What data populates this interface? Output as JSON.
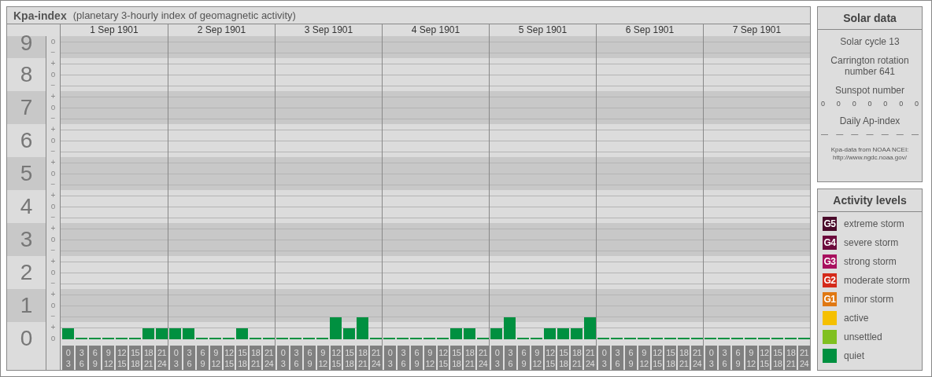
{
  "title": {
    "name": "Kpa-index",
    "subtitle": "(planetary 3-hourly index of geomagnetic activity)"
  },
  "chart": {
    "days": [
      {
        "date": "1 Sep 1901",
        "slots": [
          [
            "0",
            "3"
          ],
          [
            "3",
            "6"
          ],
          [
            "6",
            "9"
          ],
          [
            "9",
            "12"
          ],
          [
            "12",
            "15"
          ],
          [
            "15",
            "18"
          ],
          [
            "18",
            "21"
          ],
          [
            "21",
            "24"
          ]
        ]
      },
      {
        "date": "2 Sep 1901",
        "slots": [
          [
            "0",
            "3"
          ],
          [
            "3",
            "6"
          ],
          [
            "6",
            "9"
          ],
          [
            "9",
            "12"
          ],
          [
            "12",
            "15"
          ],
          [
            "15",
            "18"
          ],
          [
            "18",
            "21"
          ],
          [
            "21",
            "24"
          ]
        ]
      },
      {
        "date": "3 Sep 1901",
        "slots": [
          [
            "0",
            "3"
          ],
          [
            "3",
            "6"
          ],
          [
            "6",
            "9"
          ],
          [
            "9",
            "12"
          ],
          [
            "12",
            "15"
          ],
          [
            "15",
            "18"
          ],
          [
            "18",
            "21"
          ],
          [
            "21",
            "24"
          ]
        ]
      },
      {
        "date": "4 Sep 1901",
        "slots": [
          [
            "0",
            "3"
          ],
          [
            "3",
            "6"
          ],
          [
            "6",
            "9"
          ],
          [
            "9",
            "12"
          ],
          [
            "12",
            "15"
          ],
          [
            "15",
            "18"
          ],
          [
            "18",
            "21"
          ],
          [
            "21",
            "24"
          ]
        ]
      },
      {
        "date": "5 Sep 1901",
        "slots": [
          [
            "0",
            "3"
          ],
          [
            "3",
            "6"
          ],
          [
            "6",
            "9"
          ],
          [
            "9",
            "12"
          ],
          [
            "12",
            "15"
          ],
          [
            "15",
            "18"
          ],
          [
            "18",
            "21"
          ],
          [
            "21",
            "24"
          ]
        ]
      },
      {
        "date": "6 Sep 1901",
        "slots": [
          [
            "0",
            "3"
          ],
          [
            "3",
            "6"
          ],
          [
            "6",
            "9"
          ],
          [
            "9",
            "12"
          ],
          [
            "12",
            "15"
          ],
          [
            "15",
            "18"
          ],
          [
            "18",
            "21"
          ],
          [
            "21",
            "24"
          ]
        ]
      },
      {
        "date": "7 Sep 1901",
        "slots": [
          [
            "0",
            "3"
          ],
          [
            "3",
            "6"
          ],
          [
            "6",
            "9"
          ],
          [
            "9",
            "12"
          ],
          [
            "12",
            "15"
          ],
          [
            "15",
            "18"
          ],
          [
            "18",
            "21"
          ],
          [
            "21",
            "24"
          ]
        ]
      }
    ],
    "scale_marks": [
      [
        "o",
        "−"
      ],
      [
        "+",
        "o",
        "−"
      ],
      [
        "+",
        "o",
        "−"
      ],
      [
        "+",
        "o",
        "−"
      ],
      [
        "+",
        "o",
        "−"
      ],
      [
        "+",
        "o",
        "−"
      ],
      [
        "+",
        "o",
        "−"
      ],
      [
        "+",
        "o",
        "−"
      ],
      [
        "+",
        "o",
        "−"
      ],
      [
        "+",
        "o"
      ]
    ],
    "chart_data": {
      "type": "bar",
      "grid": true,
      "ylim": [
        0,
        9
      ],
      "yticks": [
        {
          "value": 0,
          "label": "0"
        },
        {
          "value": 1,
          "label": "1"
        },
        {
          "value": 2,
          "label": "2"
        },
        {
          "value": 3,
          "label": "3"
        },
        {
          "value": 4,
          "label": "4"
        },
        {
          "value": 5,
          "label": "5"
        },
        {
          "value": 6,
          "label": "6"
        },
        {
          "value": 7,
          "label": "7"
        },
        {
          "value": 8,
          "label": "8"
        },
        {
          "value": 9,
          "label": "9"
        }
      ],
      "values": [
        0.33,
        0,
        0,
        0,
        0,
        0,
        0.33,
        0.33,
        0.33,
        0.33,
        0,
        0,
        0,
        0.33,
        0,
        0,
        0,
        0,
        0,
        0,
        0.67,
        0.33,
        0.67,
        0,
        0,
        0,
        0,
        0,
        0,
        0.33,
        0.33,
        0,
        0.33,
        0.67,
        0,
        0,
        0.33,
        0.33,
        0.33,
        0.67,
        0,
        0,
        0,
        0,
        0,
        0,
        0,
        0,
        0,
        0,
        0,
        0,
        0,
        0,
        0,
        0
      ]
    }
  },
  "solar": {
    "title": "Solar data",
    "cycle": "Solar cycle 13",
    "rotation": "Carrington rotation number 641",
    "sunspot_label": "Sunspot number",
    "sunspots": [
      "0",
      "0",
      "0",
      "0",
      "0",
      "0",
      "0"
    ],
    "ap_label": "Daily Ap-index",
    "ap_values": [
      "—",
      "—",
      "—",
      "—",
      "—",
      "—",
      "—"
    ],
    "source": "Kpa-data from NOAA NCEI:",
    "source_url": "http://www.ngdc.noaa.gov/"
  },
  "legend": {
    "title": "Activity levels",
    "items": [
      {
        "code": "G5",
        "label": "extreme storm",
        "color": "#4a0a2a"
      },
      {
        "code": "G4",
        "label": "severe storm",
        "color": "#6c0a3c"
      },
      {
        "code": "G3",
        "label": "strong storm",
        "color": "#a8105e"
      },
      {
        "code": "G2",
        "label": "moderate storm",
        "color": "#d42a1a"
      },
      {
        "code": "G1",
        "label": "minor storm",
        "color": "#e07812"
      },
      {
        "label": "active",
        "color": "#f5c000"
      },
      {
        "label": "unsettled",
        "color": "#80c020"
      },
      {
        "label": "quiet",
        "color": "#009040"
      }
    ]
  }
}
